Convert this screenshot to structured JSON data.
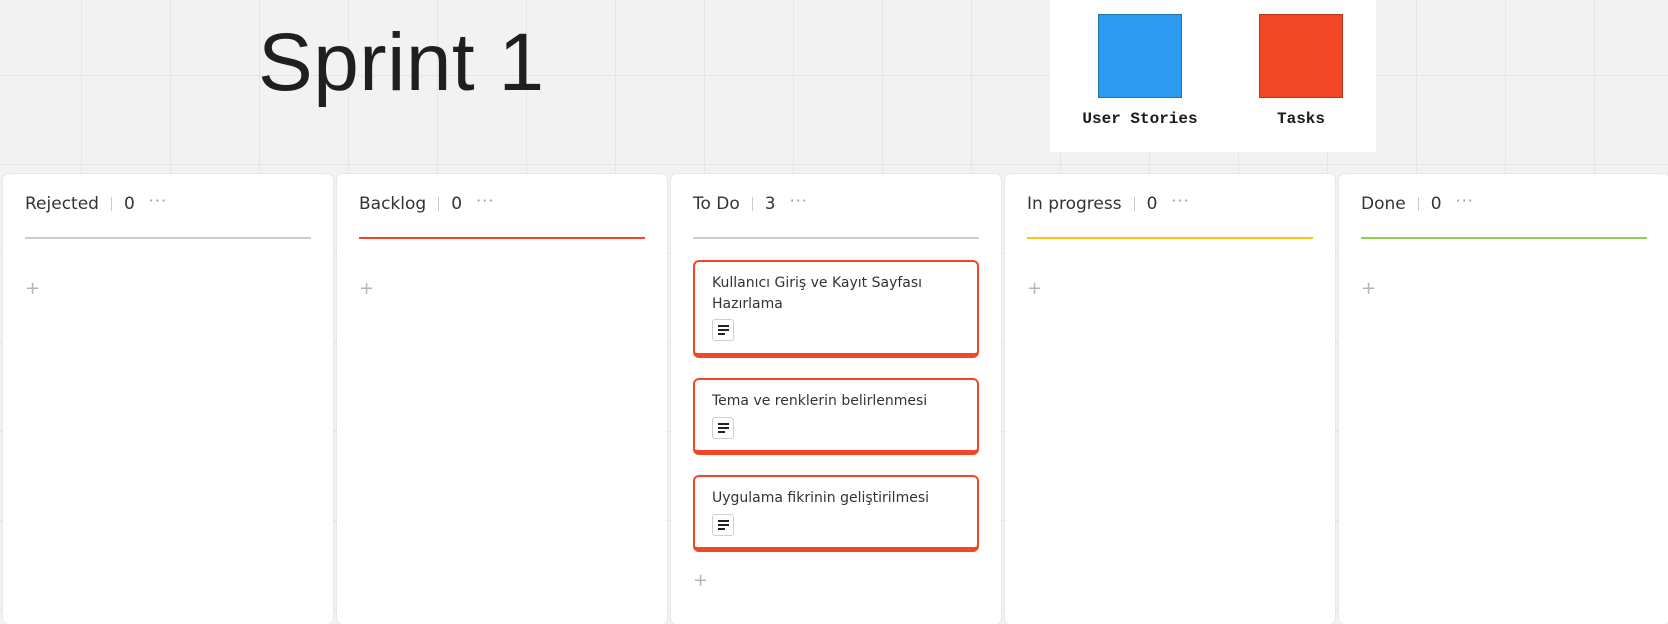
{
  "board": {
    "title": "Sprint 1"
  },
  "legend": {
    "items": [
      {
        "label": "User Stories",
        "color": "#2d9bf0"
      },
      {
        "label": "Tasks",
        "color": "#f24726"
      }
    ]
  },
  "columns": [
    {
      "name": "Rejected",
      "count": "0",
      "more": "···",
      "add": "+",
      "line_color": "#cccccc",
      "cards": []
    },
    {
      "name": "Backlog",
      "count": "0",
      "more": "···",
      "add": "+",
      "line_color": "#f24726",
      "cards": []
    },
    {
      "name": "To Do",
      "count": "3",
      "more": "···",
      "add": "+",
      "line_color": "#cccccc",
      "cards": [
        {
          "title": "Kullanıcı Giriş ve Kayıt Sayfası Hazırlama",
          "icon": "description-icon"
        },
        {
          "title": "Tema ve renklerin belirlenmesi",
          "icon": "description-icon"
        },
        {
          "title": "Uygulama fikrinin geliştirilmesi",
          "icon": "description-icon"
        }
      ]
    },
    {
      "name": "In progress",
      "count": "0",
      "more": "···",
      "add": "+",
      "line_color": "#fac710",
      "cards": []
    },
    {
      "name": "Done",
      "count": "0",
      "more": "···",
      "add": "+",
      "line_color": "#8fd14f",
      "cards": []
    }
  ]
}
